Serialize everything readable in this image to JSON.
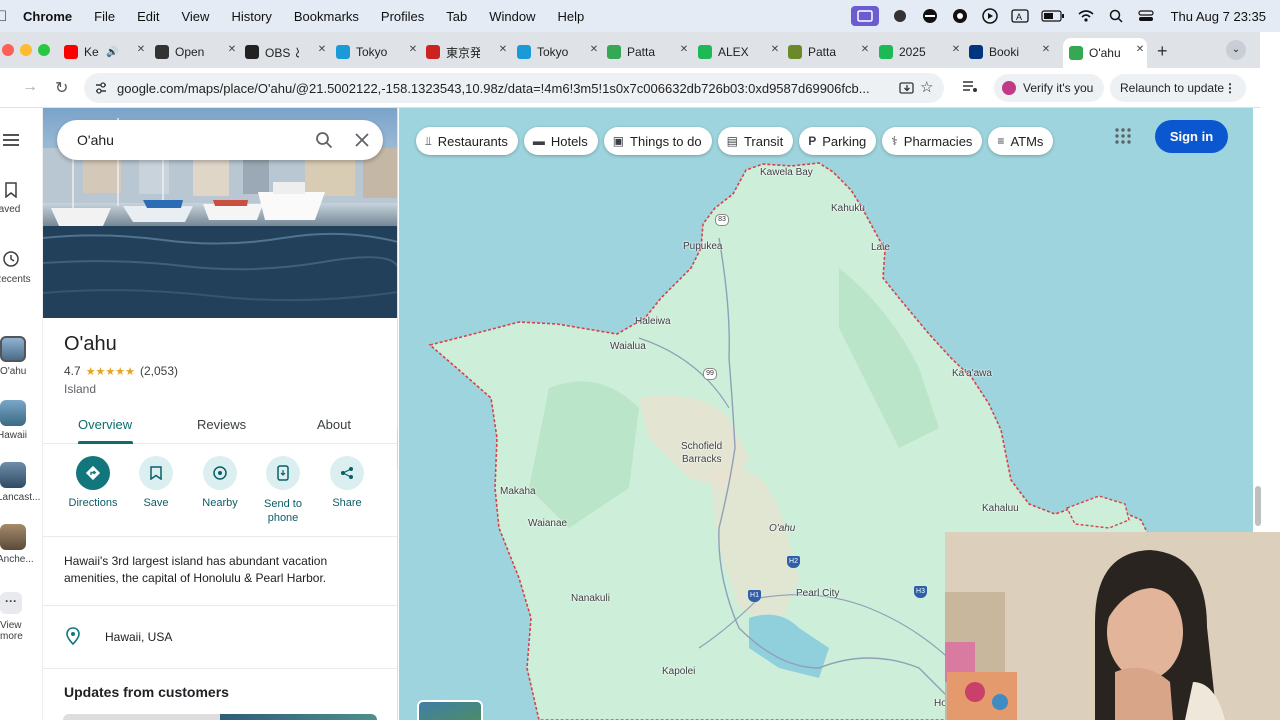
{
  "menubar": {
    "app": "Chrome",
    "items": [
      "File",
      "Edit",
      "View",
      "History",
      "Bookmarks",
      "Profiles",
      "Tab",
      "Window",
      "Help"
    ],
    "clock": "Thu Aug 7  23:35"
  },
  "tabs": [
    {
      "title": "Ke",
      "favicon_color": "#ff0000",
      "favicon": "youtube-icon"
    },
    {
      "title": "Open",
      "favicon_color": "#333333",
      "favicon": "openai-icon"
    },
    {
      "title": "OBS と",
      "favicon_color": "#222222",
      "favicon": "obs-icon"
    },
    {
      "title": "Tokyo",
      "favicon_color": "#1a9bd7",
      "favicon": "airplane-icon"
    },
    {
      "title": "東京発",
      "favicon_color": "#cc2222",
      "favicon": "bus-icon"
    },
    {
      "title": "Tokyo",
      "favicon_color": "#1a9bd7",
      "favicon": "airplane-icon"
    },
    {
      "title": "Patta",
      "favicon_color": "#34a853",
      "favicon": "maps-pin-icon"
    },
    {
      "title": "ALEX",
      "favicon_color": "#1db954",
      "favicon": "tripadvisor-icon"
    },
    {
      "title": "Patta",
      "favicon_color": "#6a8a2a",
      "favicon": "palm-icon"
    },
    {
      "title": "2025",
      "favicon_color": "#1db954",
      "favicon": "tripadvisor-icon"
    },
    {
      "title": "Booki",
      "favicon_color": "#003580",
      "favicon": "booking-icon"
    },
    {
      "title": "O'ahu",
      "favicon_color": "#34a853",
      "favicon": "maps-pin-icon"
    }
  ],
  "toolbar": {
    "url": "google.com/maps/place/O'ahu/@21.5002122,-158.1323543,10.98z/data=!4m6!3m5!1s0x7c006632db726b03:0xd9587d69906fcb...",
    "verify_label": "Verify it's you",
    "relaunch_label": "Relaunch to update"
  },
  "rail": {
    "saved": "Saved",
    "recents": "Recents",
    "recent_places": [
      "O'ahu",
      "Hawaii",
      "Lancast...",
      "Anche..."
    ],
    "view_more": [
      "View",
      "more"
    ]
  },
  "search": {
    "value": "O'ahu"
  },
  "place": {
    "title": "O'ahu",
    "rating": "4.7",
    "stars": "★★★★★",
    "reviews": "(2,053)",
    "category": "Island",
    "tabs": [
      "Overview",
      "Reviews",
      "About"
    ],
    "actions": [
      {
        "label": "Directions"
      },
      {
        "label": "Save"
      },
      {
        "label": "Nearby"
      },
      {
        "label": "Send to phone"
      },
      {
        "label": "Share"
      }
    ],
    "description": "Hawaii's 3rd largest island has abundant vacation amenities, the capital of Honolulu & Pearl Harbor.",
    "address": "Hawaii, USA",
    "updates_heading": "Updates from customers"
  },
  "map": {
    "chips": [
      {
        "label": "Restaurants",
        "icon": "fork-knife-icon"
      },
      {
        "label": "Hotels",
        "icon": "bed-icon"
      },
      {
        "label": "Things to do",
        "icon": "camera-icon"
      },
      {
        "label": "Transit",
        "icon": "train-icon"
      },
      {
        "label": "Parking",
        "icon": "parking-icon"
      },
      {
        "label": "Pharmacies",
        "icon": "pharmacy-icon"
      },
      {
        "label": "ATMs",
        "icon": "atm-icon"
      }
    ],
    "signin_label": "Sign in",
    "places": [
      "Kawela Bay",
      "Kahuku",
      "Pupukea",
      "Laie",
      "Haleiwa",
      "Waialua",
      "Ka'a'awa",
      "Schofield",
      "Barracks",
      "Makaha",
      "Waianae",
      "O'ahu",
      "Nanakuli",
      "Pearl City",
      "Kahaluu",
      "Kapolei",
      "Ho"
    ],
    "shields": {
      "s83": "83",
      "s99": "99",
      "h2": "H2",
      "h1": "H1",
      "h3": "H3"
    },
    "colors": {
      "water": "#9ed4dd",
      "land": "#cdeed9",
      "border": "#d9414a"
    }
  }
}
